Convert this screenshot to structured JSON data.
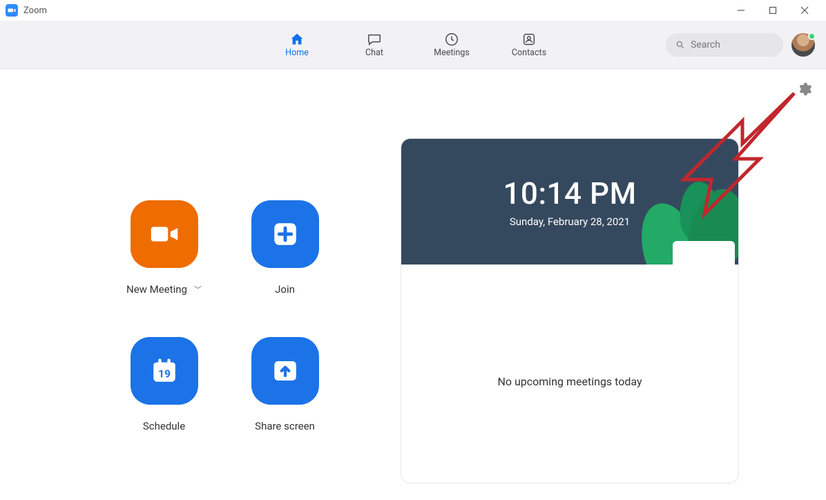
{
  "window": {
    "title": "Zoom"
  },
  "nav": {
    "home": {
      "label": "Home"
    },
    "chat": {
      "label": "Chat"
    },
    "meetings": {
      "label": "Meetings"
    },
    "contacts": {
      "label": "Contacts"
    }
  },
  "search": {
    "placeholder": "Search"
  },
  "actions": {
    "new_meeting": {
      "label": "New Meeting"
    },
    "join": {
      "label": "Join"
    },
    "schedule": {
      "label": "Schedule",
      "day": "19"
    },
    "share": {
      "label": "Share screen"
    }
  },
  "card": {
    "time": "10:14 PM",
    "date": "Sunday, February 28, 2021",
    "empty_msg": "No upcoming meetings today"
  }
}
